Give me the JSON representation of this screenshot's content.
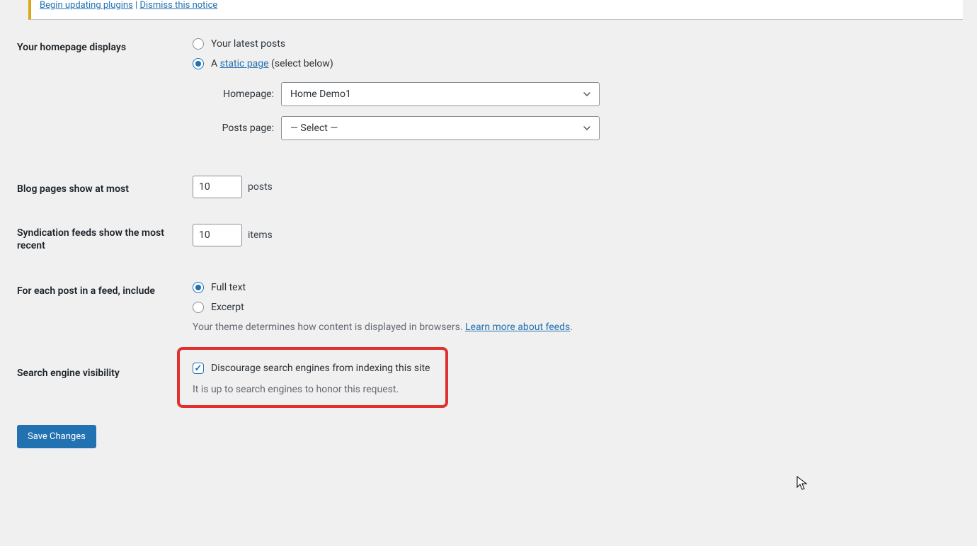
{
  "notice": {
    "link1": "Begin updating plugins",
    "sep": " | ",
    "link2": "Dismiss this notice"
  },
  "homepage": {
    "label": "Your homepage displays",
    "option_latest": "Your latest posts",
    "option_static_prefix": "A ",
    "option_static_link": "static page",
    "option_static_suffix": " (select below)",
    "homepage_label": "Homepage:",
    "homepage_value": "Home Demo1",
    "posts_label": "Posts page:",
    "posts_value": "— Select —"
  },
  "blog_pages": {
    "label": "Blog pages show at most",
    "value": "10",
    "suffix": "posts"
  },
  "syndication": {
    "label": "Syndication feeds show the most recent",
    "value": "10",
    "suffix": "items"
  },
  "feed_include": {
    "label": "For each post in a feed, include",
    "option_full": "Full text",
    "option_excerpt": "Excerpt",
    "desc_prefix": "Your theme determines how content is displayed in browsers. ",
    "desc_link": "Learn more about feeds",
    "desc_suffix": "."
  },
  "search_visibility": {
    "label": "Search engine visibility",
    "checkbox_label": "Discourage search engines from indexing this site",
    "note": "It is up to search engines to honor this request."
  },
  "save_button": "Save Changes"
}
